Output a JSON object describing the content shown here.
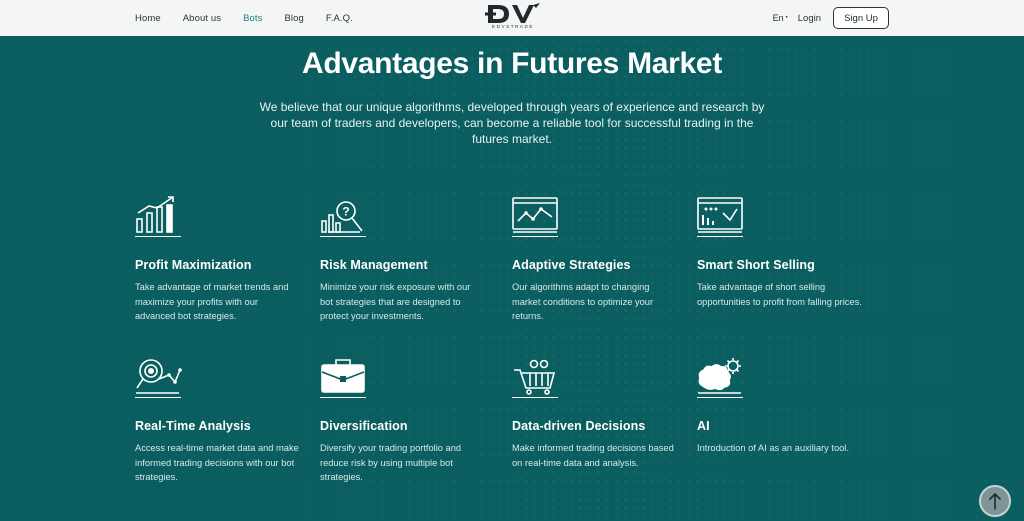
{
  "header": {
    "nav": [
      {
        "label": "Home"
      },
      {
        "label": "About us"
      },
      {
        "label": "Bots"
      },
      {
        "label": "Blog"
      },
      {
        "label": "F.A.Q."
      }
    ],
    "active_nav": "Bots",
    "logo": {
      "mark": "ĐV",
      "subtitle": "EDVSTRADE"
    },
    "language": "En",
    "login_label": "Login",
    "signup_label": "Sign Up"
  },
  "hero": {
    "title": "Advantages in Futures Market",
    "intro": "We believe that our unique algorithms, developed through years of experience and research by our team of traders and developers, can become a reliable tool for successful trading in the futures market."
  },
  "features": [
    {
      "icon": "bar-chart-growth-icon",
      "title": "Profit Maximization",
      "text": "Take advantage of market trends and maximize your profits with our advanced bot strategies."
    },
    {
      "icon": "risk-magnifier-icon",
      "title": "Risk Management",
      "text": "Minimize your risk exposure with our bot strategies that are designed to protect your investments."
    },
    {
      "icon": "line-chart-screen-icon",
      "title": "Adaptive Strategies",
      "text": "Our algorithms adapt to changing market conditions to optimize your returns."
    },
    {
      "icon": "falling-chart-screen-icon",
      "title": "Smart Short Selling",
      "text": "Take advantage of short selling opportunities to profit from falling prices."
    },
    {
      "icon": "analysis-magnifier-icon",
      "title": "Real-Time Analysis",
      "text": "Access real-time market data and make informed trading decisions with our bot strategies."
    },
    {
      "icon": "briefcase-icon",
      "title": "Diversification",
      "text": "Diversify your trading portfolio and reduce risk by using multiple bot strategies."
    },
    {
      "icon": "cart-gears-icon",
      "title": "Data-driven Decisions",
      "text": "Make informed trading decisions based on real-time data and analysis."
    },
    {
      "icon": "ai-brain-gear-icon",
      "title": "AI",
      "text": "Introduction of AI as an auxiliary tool."
    }
  ],
  "colors": {
    "background": "#0b5e60",
    "header": "#f4f6f6",
    "accent_nav": "#1d7f83"
  },
  "scroll_top_icon": "arrow-up-icon"
}
